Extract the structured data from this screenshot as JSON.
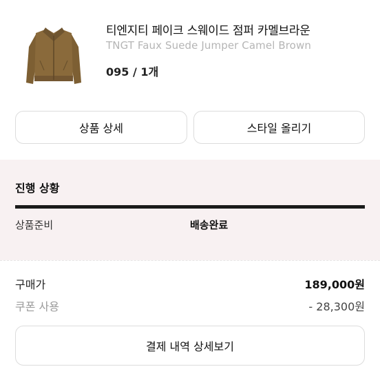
{
  "product": {
    "name_ko": "티엔지티 페이크 스웨이드 점퍼 카멜브라운",
    "name_en": "TNGT Faux Suede Jumper Camel Brown",
    "option": "095 / 1개",
    "image_icon": "camel-suede-jacket-image",
    "colors": {
      "jacket": "#8a6a3b",
      "jacket_shadow": "#6f5530"
    }
  },
  "actions": {
    "product_detail": "상품 상세",
    "style_upload": "스타일 올리기"
  },
  "progress": {
    "title": "진행 상황",
    "steps": [
      "상품준비",
      "배송완료"
    ],
    "current_step": "배송완료",
    "background_color": "#f8f1f2",
    "bar_color": "#1b1b1b"
  },
  "payment": {
    "price_label": "구매가",
    "price_value": "189,000원",
    "coupon_label": "쿠폰 사용",
    "coupon_value": "- 28,300원",
    "detail_button": "결제 내역 상세보기"
  }
}
